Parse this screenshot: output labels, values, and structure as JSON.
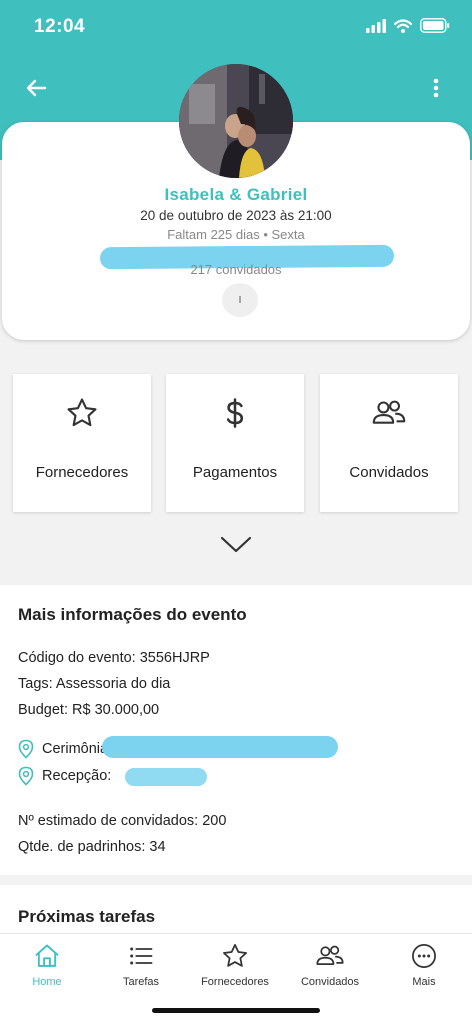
{
  "status_bar": {
    "time": "12:04"
  },
  "profile": {
    "couple_name": "Isabela & Gabriel",
    "event_date": "20 de outubro de 2023 às 21:00",
    "countdown": "Faltam 225 dias • Sexta",
    "guest_count": "217 convidados",
    "small_button_label": "I"
  },
  "tiles": [
    {
      "label": "Fornecedores",
      "icon": "star-icon"
    },
    {
      "label": "Pagamentos",
      "icon": "dollar-icon"
    },
    {
      "label": "Convidados",
      "icon": "people-icon"
    }
  ],
  "info": {
    "title": "Mais informações do evento",
    "code_label": "Código do evento:",
    "code_value": "3556HJRP",
    "tags_label": "Tags:",
    "tags_value": "Assessoria do dia",
    "budget_label": "Budget:",
    "budget_value": "R$ 30.000,00",
    "ceremony_label": "Cerimônia:",
    "reception_label": "Recepção:",
    "estimated_guests_label": "Nº estimado de convidados:",
    "estimated_guests_value": "200",
    "godparents_label": "Qtde. de padrinhos:",
    "godparents_value": "34"
  },
  "tasks": {
    "title": "Próximas tarefas"
  },
  "nav": [
    {
      "label": "Home",
      "icon": "home-icon",
      "active": true
    },
    {
      "label": "Tarefas",
      "icon": "list-icon",
      "active": false
    },
    {
      "label": "Fornecedores",
      "icon": "star-icon",
      "active": false
    },
    {
      "label": "Convidados",
      "icon": "people-icon",
      "active": false
    },
    {
      "label": "Mais",
      "icon": "more-circle-icon",
      "active": false
    }
  ],
  "colors": {
    "accent": "#3fbfbd",
    "redaction": "#7cd3f0"
  }
}
